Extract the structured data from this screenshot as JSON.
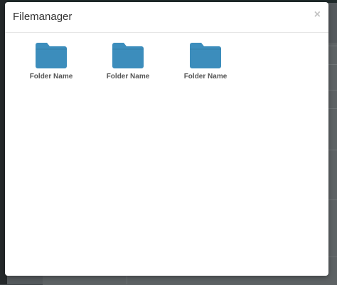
{
  "modal": {
    "title": "Filemanager",
    "close_label": "×"
  },
  "folders": [
    {
      "name": "Folder Name",
      "icon": "folder-icon"
    },
    {
      "name": "Folder Name",
      "icon": "folder-icon"
    },
    {
      "name": "Folder Name",
      "icon": "folder-icon"
    }
  ],
  "colors": {
    "folder": "#3c8dbc",
    "backdrop": "#555a5d"
  }
}
